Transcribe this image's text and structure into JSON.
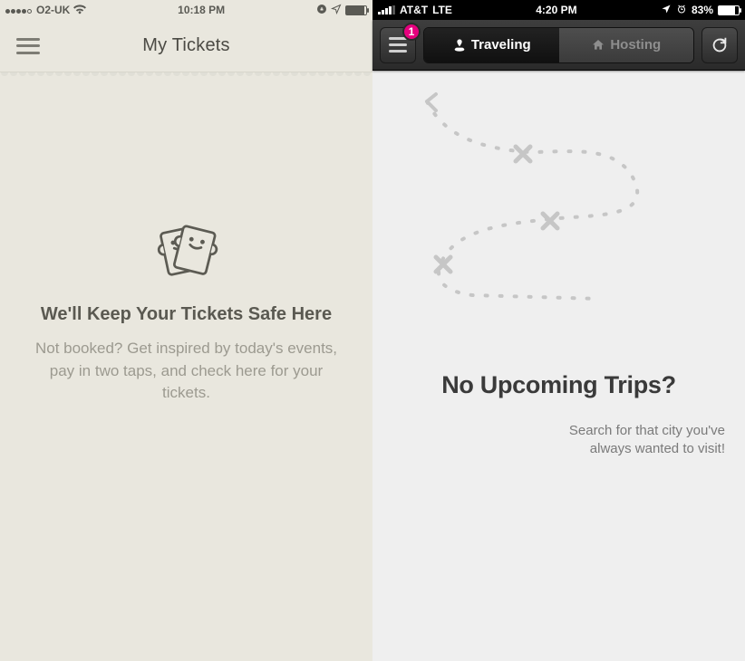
{
  "left": {
    "status": {
      "carrier": "O2-UK",
      "time": "10:18 PM"
    },
    "nav": {
      "title": "My Tickets"
    },
    "empty": {
      "heading": "We'll Keep Your Tickets Safe Here",
      "body": "Not booked? Get inspired by today's events, pay in two taps, and check here for your tickets."
    }
  },
  "right": {
    "status": {
      "carrier": "AT&T",
      "network": "LTE",
      "time": "4:20 PM",
      "battery_pct": "83%"
    },
    "nav": {
      "badge_count": "1",
      "tab_traveling": "Traveling",
      "tab_hosting": "Hosting"
    },
    "empty": {
      "heading": "No Upcoming Trips?",
      "body": "Search for that city you've always wanted to visit!"
    }
  }
}
